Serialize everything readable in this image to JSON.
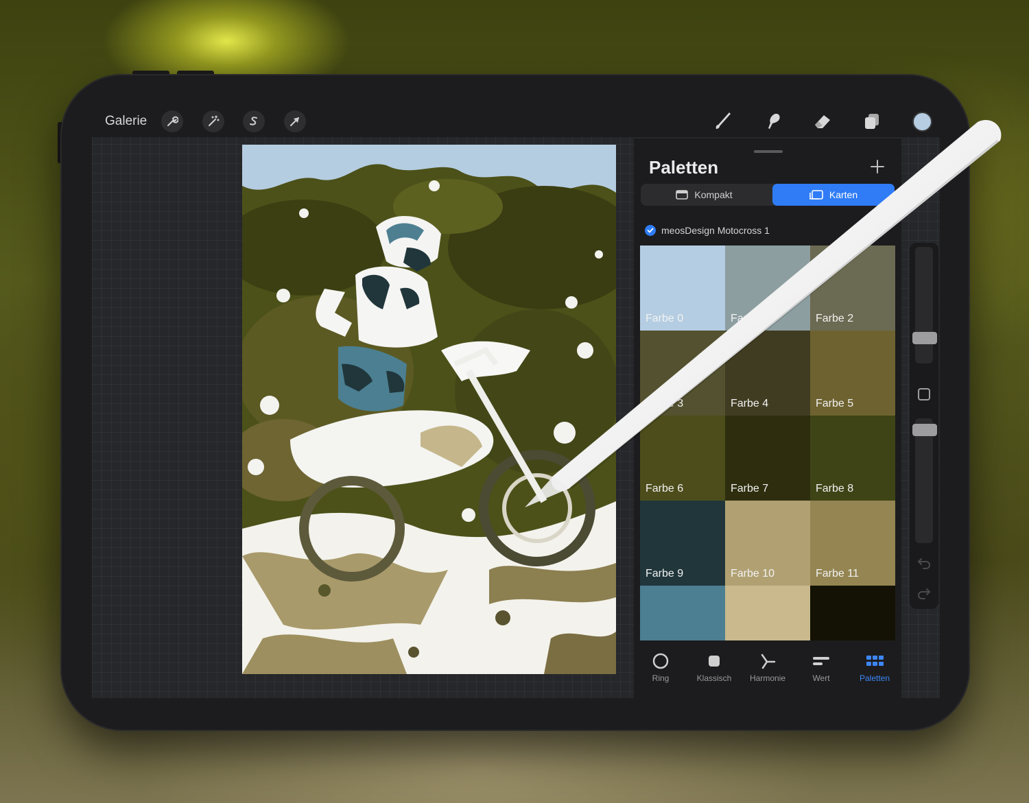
{
  "toolbar": {
    "gallery_label": "Galerie",
    "left_tools": [
      "wrench-icon",
      "magic-wand-icon",
      "selection-icon",
      "transform-arrow-icon"
    ],
    "right_tools": [
      "brush-icon",
      "smudge-icon",
      "eraser-icon",
      "layers-icon"
    ],
    "current_color": "#b6cde2"
  },
  "palettes_panel": {
    "title": "Paletten",
    "view_modes": [
      {
        "label": "Kompakt",
        "active": false
      },
      {
        "label": "Karten",
        "active": true
      }
    ],
    "palette_name": "meosDesign Motocross 1",
    "swatches": [
      {
        "label": "Farbe 0",
        "color": "#b4cde2"
      },
      {
        "label": "Farbe 1",
        "color": "#8d9ea0"
      },
      {
        "label": "Farbe 2",
        "color": "#6b6a52"
      },
      {
        "label": "Farbe 3",
        "color": "#53512f"
      },
      {
        "label": "Farbe 4",
        "color": "#403c22"
      },
      {
        "label": "Farbe 5",
        "color": "#6e6330"
      },
      {
        "label": "Farbe 6",
        "color": "#4c4d1b"
      },
      {
        "label": "Farbe 7",
        "color": "#2e2e0f"
      },
      {
        "label": "Farbe 8",
        "color": "#3f4416"
      },
      {
        "label": "Farbe 9",
        "color": "#20363b"
      },
      {
        "label": "Farbe 10",
        "color": "#b1a172"
      },
      {
        "label": "Farbe 11",
        "color": "#948552"
      },
      {
        "label": "",
        "color": "#4b7f91"
      },
      {
        "label": "",
        "color": "#c9b98c"
      },
      {
        "label": "",
        "color": "#141205"
      }
    ]
  },
  "bottom_tabs": [
    {
      "label": "Ring",
      "icon": "ring-icon",
      "active": false
    },
    {
      "label": "Klassisch",
      "icon": "square-icon",
      "active": false
    },
    {
      "label": "Harmonie",
      "icon": "harmony-icon",
      "active": false
    },
    {
      "label": "Wert",
      "icon": "value-sliders-icon",
      "active": false
    },
    {
      "label": "Paletten",
      "icon": "palettes-grid-icon",
      "active": true
    }
  ],
  "colors": {
    "accent": "#2f7cf6",
    "panel_bg": "#1c1c1e"
  }
}
